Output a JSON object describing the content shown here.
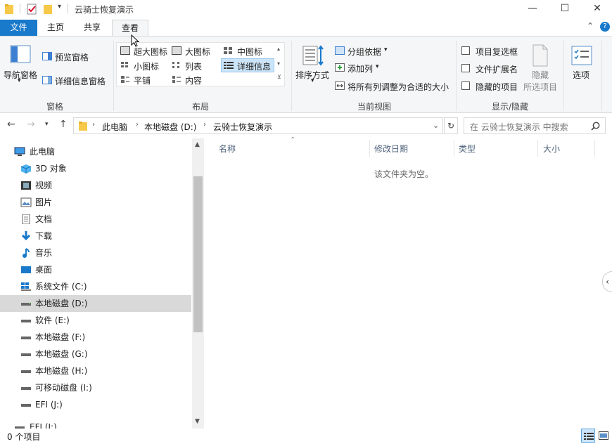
{
  "window": {
    "title": "云骑士恢复演示",
    "minimize": "—",
    "maximize": "☐",
    "close": "✕"
  },
  "tabs": {
    "file": "文件",
    "home": "主页",
    "share": "共享",
    "view": "查看"
  },
  "ribbon": {
    "panes": {
      "nav_pane": "导航窗格",
      "preview_pane": "预览窗格",
      "details_pane": "详细信息窗格",
      "label": "窗格"
    },
    "layout": {
      "xl_icons": "超大图标",
      "large_icons": "大图标",
      "medium_icons": "中图标",
      "small_icons": "小图标",
      "list": "列表",
      "details": "详细信息",
      "tiles": "平铺",
      "content": "内容",
      "label": "布局"
    },
    "current_view": {
      "sort_by": "排序方式",
      "group_by": "分组依据",
      "add_columns": "添加列",
      "size_all_columns": "将所有列调整为合适的大小",
      "label": "当前视图"
    },
    "show_hide": {
      "item_checkboxes": "项目复选框",
      "file_extensions": "文件扩展名",
      "hidden_items": "隐藏的项目",
      "hide_selected_1": "隐藏",
      "hide_selected_2": "所选项目",
      "label": "显示/隐藏"
    },
    "options": "选项"
  },
  "address": {
    "path": [
      "此电脑",
      "本地磁盘 (D:)",
      "云骑士恢复演示"
    ],
    "search_placeholder": "在 云骑士恢复演示 中搜索"
  },
  "nav": {
    "items": [
      {
        "label": "此电脑",
        "icon": "computer-icon"
      },
      {
        "label": "3D 对象",
        "icon": "3d-objects-icon"
      },
      {
        "label": "视频",
        "icon": "video-icon"
      },
      {
        "label": "图片",
        "icon": "pictures-icon"
      },
      {
        "label": "文档",
        "icon": "documents-icon"
      },
      {
        "label": "下载",
        "icon": "download-icon"
      },
      {
        "label": "音乐",
        "icon": "music-icon"
      },
      {
        "label": "桌面",
        "icon": "desktop-icon"
      },
      {
        "label": "系统文件 (C:)",
        "icon": "windows-drive-icon"
      },
      {
        "label": "本地磁盘 (D:)",
        "icon": "drive-icon"
      },
      {
        "label": "软件 (E:)",
        "icon": "drive-icon"
      },
      {
        "label": "本地磁盘 (F:)",
        "icon": "drive-icon"
      },
      {
        "label": "本地磁盘 (G:)",
        "icon": "drive-icon"
      },
      {
        "label": "本地磁盘 (H:)",
        "icon": "drive-icon"
      },
      {
        "label": "可移动磁盘 (I:)",
        "icon": "drive-icon"
      },
      {
        "label": "EFI (J:)",
        "icon": "drive-icon"
      },
      {
        "label": "EFI (J:)",
        "icon": "drive-icon"
      }
    ]
  },
  "content": {
    "columns": [
      "名称",
      "修改日期",
      "类型",
      "大小"
    ],
    "empty_message": "该文件夹为空。"
  },
  "status": {
    "item_count": "0 个项目"
  },
  "colors": {
    "accent": "#1979ca",
    "selection": "#d9d9d9",
    "header_text": "#4c607a"
  }
}
